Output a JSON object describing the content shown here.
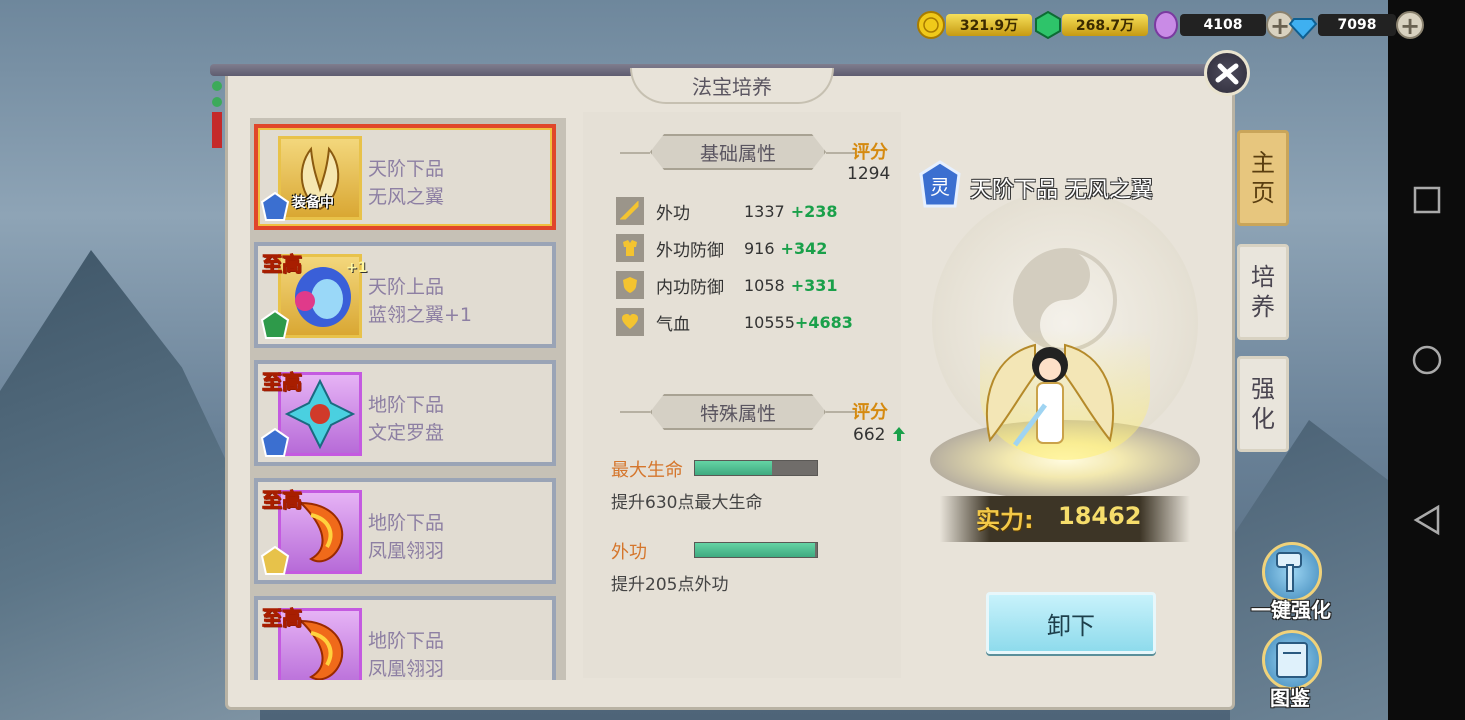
{
  "currency": [
    {
      "icon": "gold-coin-icon",
      "value": "321.9万",
      "color": "#f0c91a"
    },
    {
      "icon": "green-gem-icon",
      "value": "268.7万",
      "color": "#2ec46a"
    },
    {
      "icon": "purple-crystal-icon",
      "value": "4108",
      "color": "#c98be6"
    },
    {
      "icon": "diamond-icon",
      "value": "7098",
      "color": "#3fb0f0"
    }
  ],
  "panel": {
    "title": "法宝培养"
  },
  "items": [
    {
      "tier": "天阶下品",
      "name": "无风之翼",
      "equipped_label": "装备中",
      "badge": "灵",
      "selected": true,
      "icon": "golden-wing-icon",
      "frame": "gold"
    },
    {
      "tier": "天阶上品",
      "name": "蓝翎之翼+1",
      "level_label": "+1",
      "top_tag": "至高",
      "badge": "妖",
      "icon": "blue-feather-wing-icon",
      "frame": "gold"
    },
    {
      "tier": "地阶下品",
      "name": "文定罗盘",
      "top_tag": "至高",
      "badge": "灵",
      "icon": "compass-icon",
      "frame": "purple"
    },
    {
      "tier": "地阶下品",
      "name": "凤凰翎羽",
      "top_tag": "至高",
      "badge": "神",
      "icon": "phoenix-feather-icon",
      "frame": "purple"
    },
    {
      "tier": "地阶下品",
      "name": "凤凰翎羽",
      "top_tag": "至高",
      "badge": "神",
      "icon": "phoenix-feather-icon",
      "frame": "purple"
    }
  ],
  "basic": {
    "header": "基础属性",
    "score_label": "评分",
    "score": "1294",
    "stats": [
      {
        "icon": "sword-icon",
        "name": "外功",
        "value": "1337",
        "bonus": "+238"
      },
      {
        "icon": "armor-icon",
        "name": "外功防御",
        "value": "916",
        "bonus": "+342"
      },
      {
        "icon": "shield-icon",
        "name": "内功防御",
        "value": "1058",
        "bonus": "+331"
      },
      {
        "icon": "heart-icon",
        "name": "气血",
        "value": "10555",
        "bonus": "+4683"
      }
    ]
  },
  "special": {
    "header": "特殊属性",
    "score_label": "评分",
    "score": "662",
    "attrs": [
      {
        "name": "最大生命",
        "progress": 0.63,
        "desc": "提升630点最大生命"
      },
      {
        "name": "外功",
        "progress": 0.98,
        "desc": "提升205点外功"
      }
    ]
  },
  "display": {
    "title": "天阶下品 无风之翼",
    "badge": "灵",
    "power_label": "实力:",
    "power_value": "18462",
    "unequip_label": "卸下"
  },
  "side_tabs": [
    {
      "label_top": "主",
      "label_bottom": "页",
      "active": true
    },
    {
      "label_top": "培",
      "label_bottom": "养",
      "active": false
    },
    {
      "label_top": "强",
      "label_bottom": "化",
      "active": false
    }
  ],
  "bottom_buttons": [
    {
      "label": "一键强化",
      "icon": "hammer-icon"
    },
    {
      "label": "图鉴",
      "icon": "book-icon"
    }
  ],
  "colors": {
    "accent_gold": "#d58a10",
    "bonus_green": "#1aa04a",
    "selected_border": "#e0462a"
  }
}
